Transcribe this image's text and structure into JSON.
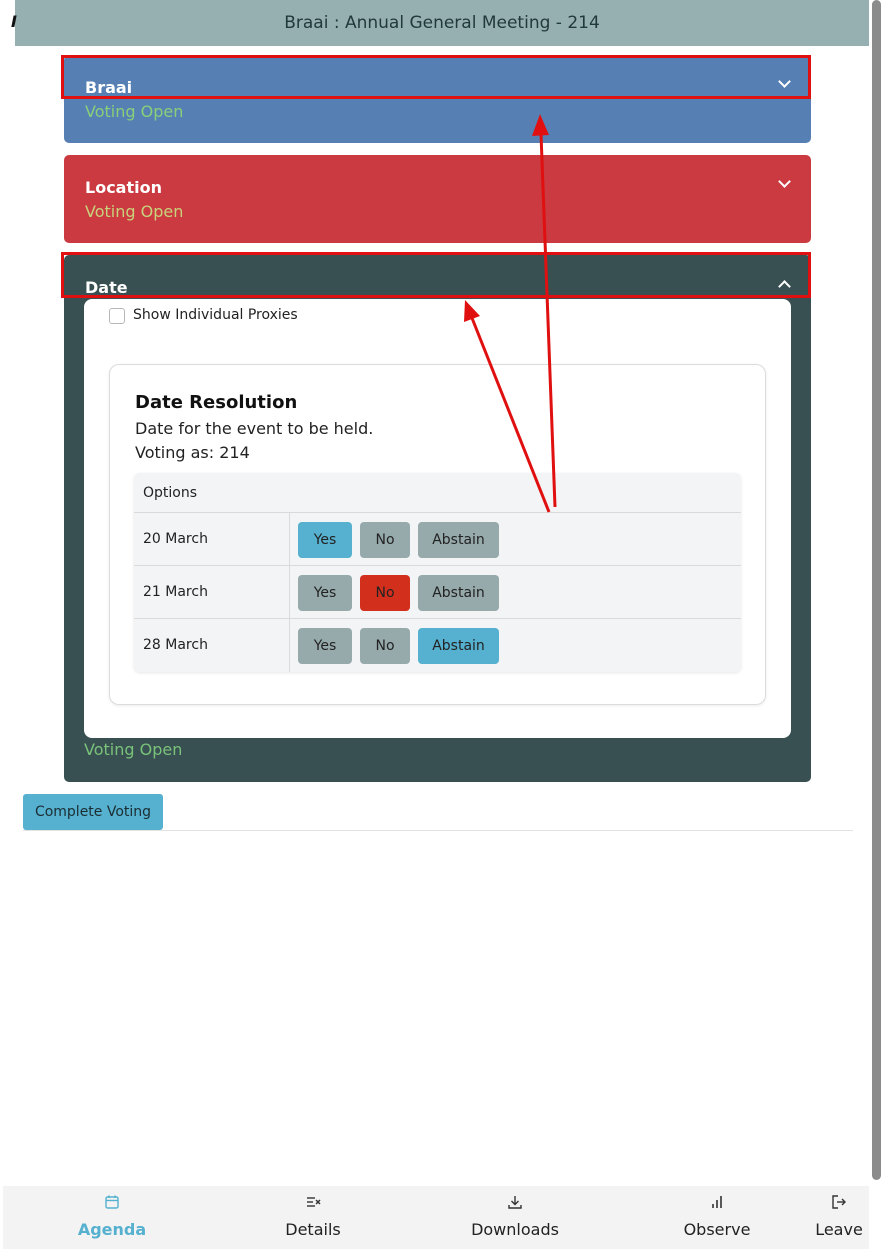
{
  "window": {
    "title": "Braai : Annual General Meeting - 214",
    "stray_glyph": "I"
  },
  "panels": [
    {
      "title": "Braai",
      "status": "Voting Open",
      "color": "#5680b3",
      "status_color": "#88cf7a",
      "expanded": false
    },
    {
      "title": "Location",
      "status": "Voting Open",
      "color": "#cb3a40",
      "status_color": "#c8d27c",
      "expanded": false
    },
    {
      "title": "Date",
      "status": "Voting Open",
      "color": "#385052",
      "status_color": "#7ac27a",
      "expanded": true
    }
  ],
  "date_panel": {
    "show_proxies_label": "Show Individual Proxies",
    "show_proxies_checked": false,
    "resolution": {
      "title": "Date Resolution",
      "description": "Date for the event to be held.",
      "voting_as": "Voting as: 214",
      "options_header": "Options",
      "buttons": {
        "yes": "Yes",
        "no": "No",
        "abstain": "Abstain"
      },
      "options": [
        {
          "label": "20 March",
          "selected": "yes"
        },
        {
          "label": "21 March",
          "selected": "no"
        },
        {
          "label": "28 March",
          "selected": "abstain"
        }
      ]
    }
  },
  "complete_voting_label": "Complete Voting",
  "colors": {
    "yes_selected": "#55b1cf",
    "no_selected": "#d22f1c",
    "abstain_selected": "#55b1cf",
    "unselected": "#96a9ab",
    "annotation_red": "#e01010",
    "nav_active": "#55b1cf"
  },
  "nav": {
    "items": [
      {
        "label": "Agenda",
        "icon": "calendar-icon",
        "active": true
      },
      {
        "label": "Details",
        "icon": "list-icon",
        "active": false
      },
      {
        "label": "Downloads",
        "icon": "download-icon",
        "active": false
      },
      {
        "label": "Observe",
        "icon": "bar-chart-icon",
        "active": false
      },
      {
        "label": "Leave",
        "icon": "logout-icon",
        "active": false
      }
    ]
  }
}
